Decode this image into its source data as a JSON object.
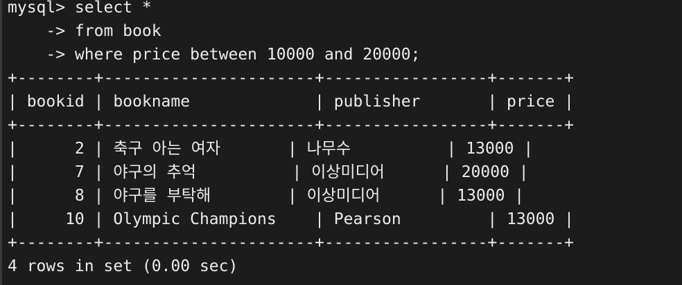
{
  "terminal": {
    "lines": [
      "mysql> select *",
      "    -> from book",
      "    -> where price between 10000 and 20000;",
      "+--------+----------------------+-----------------+-------+",
      "| bookid | bookname             | publisher       | price |",
      "+--------+----------------------+-----------------+-------+",
      "|      2 | 축구 아는 여자       | 나무수          | 13000 |",
      "|      7 | 야구의 추억          | 이상미디어      | 20000 |",
      "|      8 | 야구를 부탁해        | 이상미디어      | 13000 |",
      "|     10 | Olympic Champions    | Pearson         | 13000 |",
      "+--------+----------------------+-----------------+-------+",
      "4 rows in set (0.00 sec)"
    ]
  },
  "query": {
    "prompt": "mysql>",
    "statement": "select * from book where price between 10000 and 20000;"
  },
  "result": {
    "columns": [
      "bookid",
      "bookname",
      "publisher",
      "price"
    ],
    "rows": [
      [
        "2",
        "축구 아는 여자",
        "나무수",
        "13000"
      ],
      [
        "7",
        "야구의 추억",
        "이상미디어",
        "20000"
      ],
      [
        "8",
        "야구를 부탁해",
        "이상미디어",
        "13000"
      ],
      [
        "10",
        "Olympic Champions",
        "Pearson",
        "13000"
      ]
    ],
    "summary": "4 rows in set (0.00 sec)"
  },
  "colors": {
    "background": "#1c1c1c",
    "foreground": "#ececec"
  }
}
